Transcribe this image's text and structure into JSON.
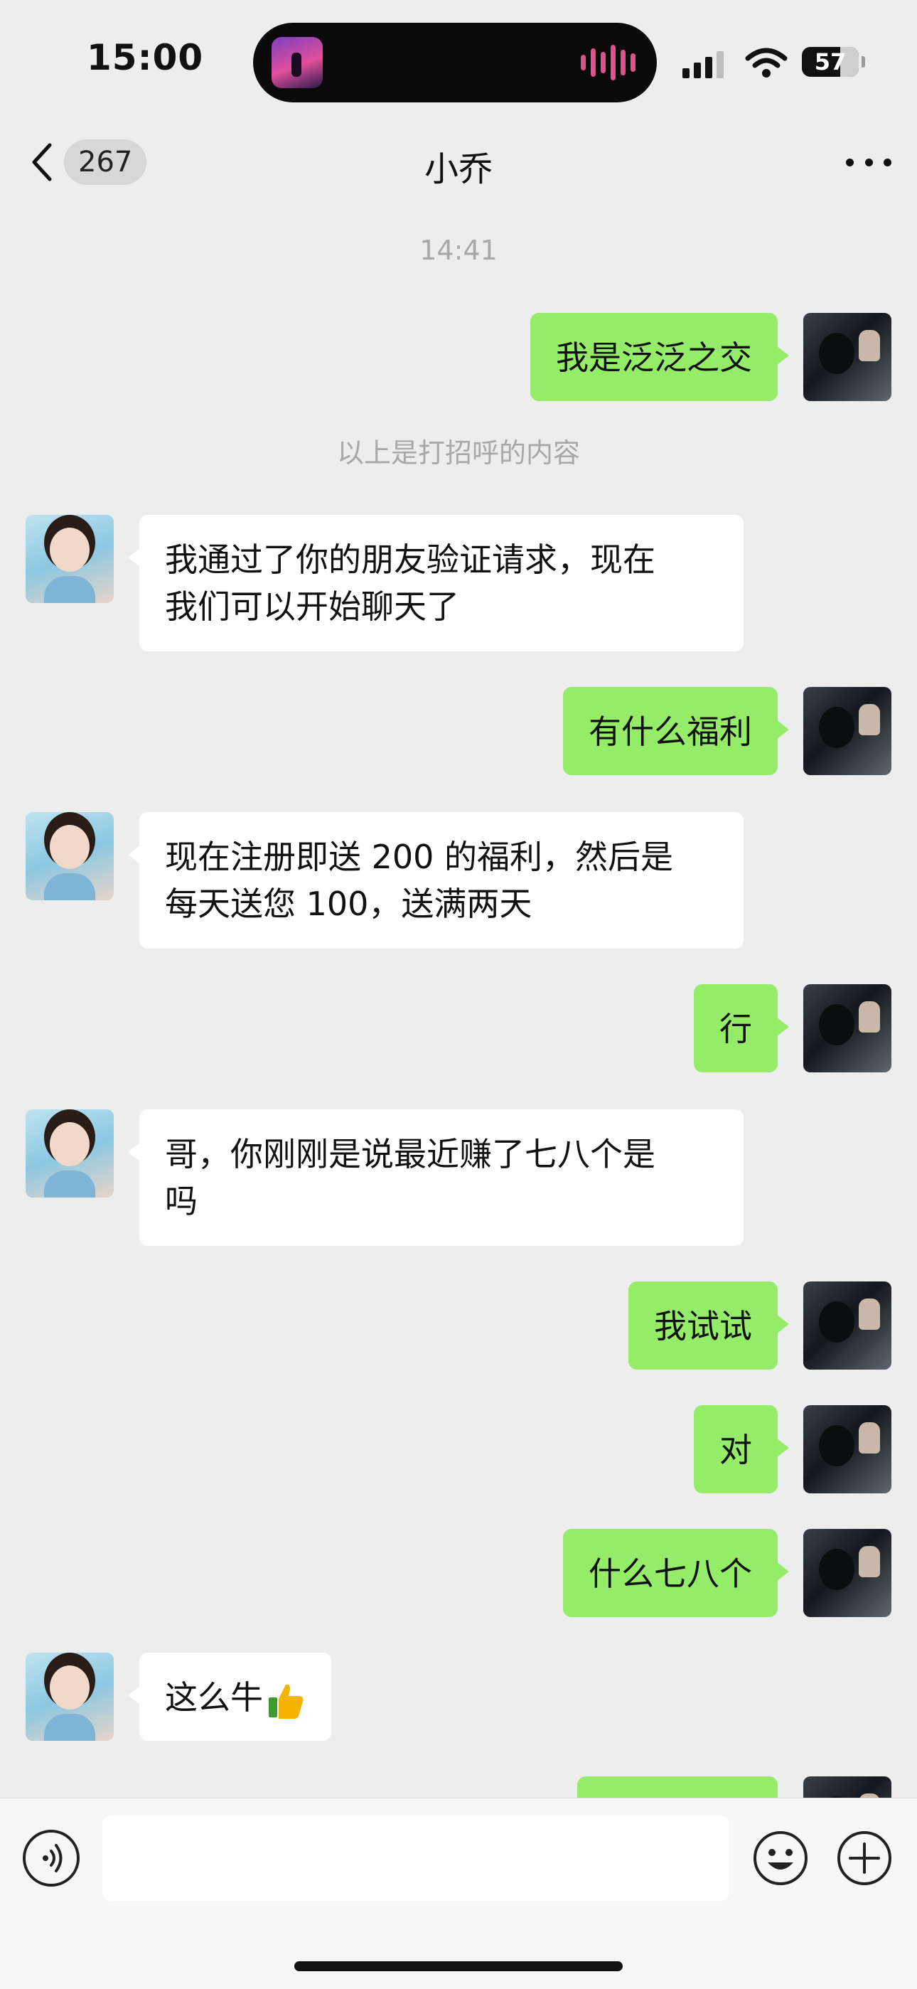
{
  "status_bar": {
    "time": "15:00",
    "battery": "57"
  },
  "nav": {
    "back_count": "267",
    "title": "小乔"
  },
  "chat": {
    "timestamp": "14:41",
    "system_note": "以上是打招呼的内容",
    "messages": [
      {
        "from": "me",
        "text": "我是泛泛之交"
      },
      {
        "from": "her",
        "line1": "我通过了你的朋友验证请求，现在",
        "line2": "我们可以开始聊天了"
      },
      {
        "from": "me",
        "text": "有什么福利"
      },
      {
        "from": "her",
        "line1": "现在注册即送 200 的福利，然后是",
        "line2": "每天送您 100，送满两天"
      },
      {
        "from": "me",
        "text": "行"
      },
      {
        "from": "her",
        "line1": "哥，你刚刚是说最近赚了七八个是",
        "line2": "吗"
      },
      {
        "from": "me",
        "text": "我试试"
      },
      {
        "from": "me",
        "text": "对"
      },
      {
        "from": "me",
        "text": "什么七八个"
      },
      {
        "from": "her",
        "text": "这么牛",
        "emoji": "thumbs-up-icon"
      }
    ]
  },
  "input_bar": {
    "placeholder": ""
  },
  "colors": {
    "sent_bubble": "#95ec69",
    "received_bubble": "#ffffff",
    "background": "#ededed",
    "wave_accent": "#e0508a"
  }
}
